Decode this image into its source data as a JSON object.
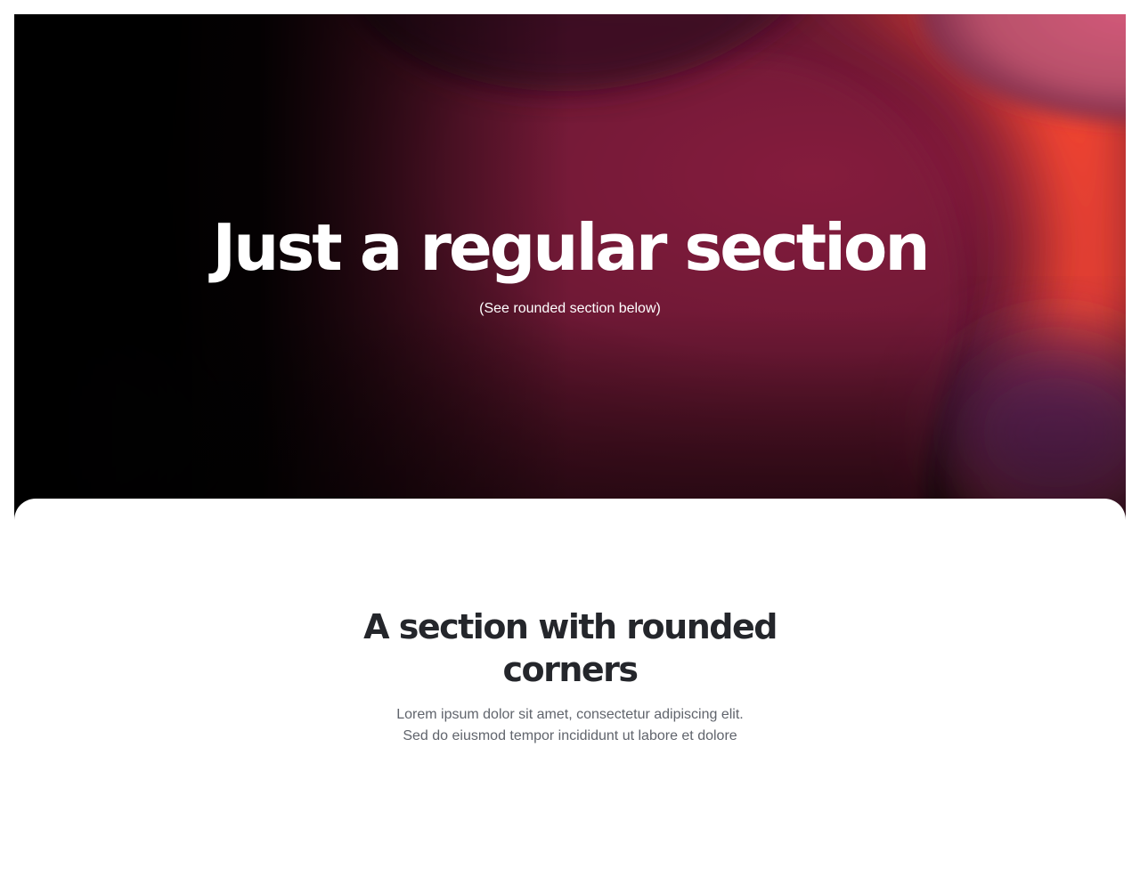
{
  "hero": {
    "title": "Just a regular section",
    "subtitle": "(See rounded section below)",
    "colors": {
      "base": "#000000",
      "blob_crimson": "#8a1a3c",
      "blob_orange": "#ff4a30",
      "blob_pink": "#c24a6e",
      "blob_purple": "#4a1c4e"
    }
  },
  "rounded_section": {
    "title": "A section with rounded corners",
    "body_line_1": "Lorem ipsum dolor sit amet, consectetur adipiscing elit.",
    "body_line_2": "Sed do eiusmod tempor incididunt ut labore et dolore",
    "colors": {
      "background": "#ffffff",
      "title": "#24262b",
      "body": "#60646c"
    }
  }
}
